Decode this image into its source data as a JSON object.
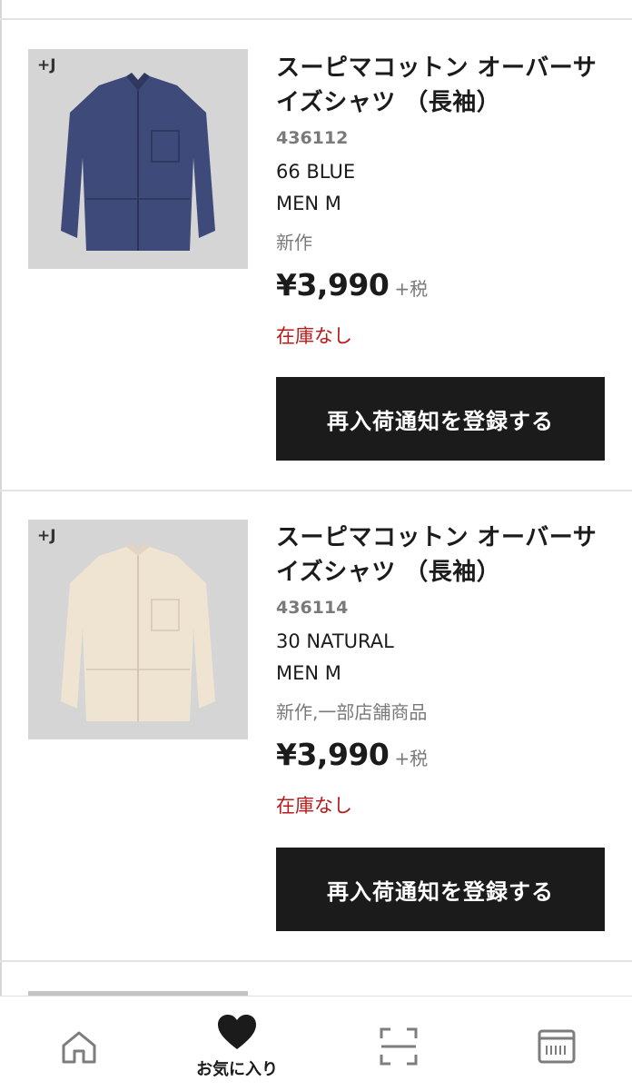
{
  "products": [
    {
      "brand_mark": "+J",
      "name": "スーピマコットン オーバーサイズシャツ （長袖）",
      "code": "436112",
      "color": "66 BLUE",
      "size": "MEN M",
      "flags": "新作",
      "price": "¥3,990",
      "tax": "+税",
      "stock": "在庫なし",
      "button_label": "再入荷通知を登録する",
      "shirt_color": "#3e4a7a"
    },
    {
      "brand_mark": "+J",
      "name": "スーピマコットン オーバーサイズシャツ （長袖）",
      "code": "436114",
      "color": "30 NATURAL",
      "size": "MEN M",
      "flags": "新作,一部店舗商品",
      "price": "¥3,990",
      "tax": "+税",
      "stock": "在庫なし",
      "button_label": "再入荷通知を登録する",
      "shirt_color": "#efe3d2"
    }
  ],
  "bottom_nav": [
    {
      "icon": "home-icon",
      "label": ""
    },
    {
      "icon": "heart-icon",
      "label": "お気に入り",
      "active": true
    },
    {
      "icon": "scan-icon",
      "label": ""
    },
    {
      "icon": "membership-card-icon",
      "label": ""
    }
  ],
  "colors": {
    "button_bg": "#1b1b1b",
    "stock_red": "#b81b1b",
    "muted_gray": "#7a7a7a"
  }
}
